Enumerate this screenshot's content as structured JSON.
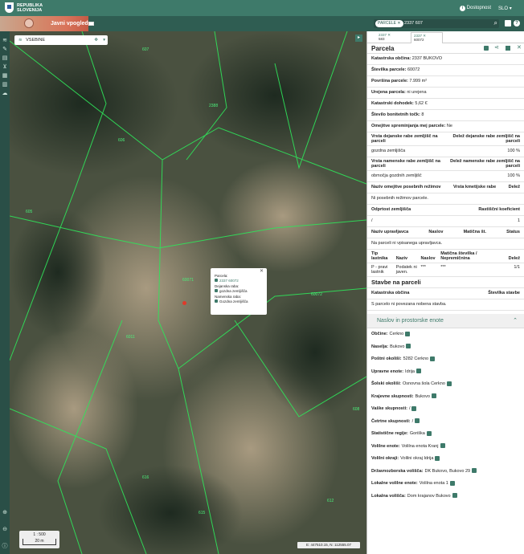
{
  "topbar": {
    "logo_line1": "REPUBLIKA",
    "logo_line2": "SLOVENIJA",
    "accessibility": "Dostopnost",
    "language": "SLO"
  },
  "subbar": {
    "app_title": "Javni vpogled",
    "search_chip": "PARCELE",
    "search_value": "2337 607"
  },
  "map": {
    "layer_select": "VSEBINE",
    "scale_ratio": "1 : 500",
    "scale_length": "20 m",
    "coords": "E: 447510.15, N: 112555.07",
    "popup": {
      "parcel_label": "Parcela:",
      "parcel_value": "2337 60072",
      "dejanska_label": "Dejanska raba:",
      "dejanska_value": "gozdna zemljišča",
      "namenska_label": "Namenska raba:",
      "namenska_value": "Gozdna zemljišča"
    },
    "parcel_labels": [
      "607",
      "2388",
      "606",
      "605",
      "60071",
      "60072",
      "608",
      "6011",
      "616",
      "615",
      "612"
    ]
  },
  "panel": {
    "tab1_line1": "2337 ✕",
    "tab1_line2": "583",
    "tab2_line1": "2337 ✕",
    "tab2_line2": "60072",
    "title": "Parcela",
    "katastrska_obcina_label": "Katastrska občina:",
    "katastrska_obcina_value": "2337 BUKOVO",
    "stevilka_label": "Številka parcele:",
    "stevilka_value": "60072",
    "povrsina_label": "Površina parcele:",
    "povrsina_value": "7.999 m²",
    "urejena_label": "Urejena parcela:",
    "urejena_value": "ni urejena",
    "dohodek_label": "Katastrski dohodek:",
    "dohodek_value": "5,62 €",
    "tock_label": "Število bonitetnih točk:",
    "tock_value": "8",
    "omejitve_label": "Omejitve spreminjanja mej parcele:",
    "omejitve_value": "Ne",
    "dej_head1": "Vrsta dejanske rabe zemljišč na parceli",
    "dej_head2": "Delež dejanske rabe zemljišč na parceli",
    "dej_val1": "gozdna zemljišča",
    "dej_val2": "100 %",
    "nam_head1": "Vrsta namenske rabe zemljišč na parceli",
    "nam_head2": "Delež namenske rabe zemljišč na parceli",
    "nam_val1": "območja gozdnih zemljišč",
    "nam_val2": "100 %",
    "rez_head1": "Naziv omejitve posebnih režimov",
    "rez_head2": "Vrsta kmetijske rabe",
    "rez_head3": "Delež",
    "rez_note": "Ni posebnih režimov parcele.",
    "odp_head1": "Odprtost zemljišča",
    "odp_head2": "Rastiščni koeficient",
    "odp_val1": "/",
    "odp_val2": "1",
    "upr_h1": "Naziv upravljavca",
    "upr_h2": "Naslov",
    "upr_h3": "Matična št.",
    "upr_h4": "Status",
    "upr_note": "Na parceli ni vpisanega upravljavca.",
    "last_h1": "Tip lastnika",
    "last_h2": "Naziv",
    "last_h3": "Naslov",
    "last_h4": "Matična številka / Nepremičnina",
    "last_h5": "Delež",
    "last_v1": "P - pravi lastnik",
    "last_v2": "Podatek ni javen.",
    "last_v3": "***",
    "last_v4": "***",
    "last_v5": "1/1",
    "stavbe_title": "Stavbe na parceli",
    "stavbe_h1": "Katastrska občina",
    "stavbe_h2": "Številka stavbe",
    "stavbe_note": "S parcelo ni povezana nobena stavba.",
    "naslov_section": "Naslov in prostorske enote",
    "enote": [
      {
        "label": "Občine:",
        "value": "Cerkno"
      },
      {
        "label": "Naselja:",
        "value": "Bukovo"
      },
      {
        "label": "Poštni okoliši:",
        "value": "5282 Cerkno"
      },
      {
        "label": "Upravne enote:",
        "value": "Idrija"
      },
      {
        "label": "Šolski okoliši:",
        "value": "Osnovna šola Cerkno"
      },
      {
        "label": "Krajevne skupnosti:",
        "value": "Bukovo"
      },
      {
        "label": "Vaške skupnosti:",
        "value": "/"
      },
      {
        "label": "Četrtne skupnosti:",
        "value": "/"
      },
      {
        "label": "Statistične regije:",
        "value": "Goriška"
      },
      {
        "label": "Volilne enote:",
        "value": "Volilna enota Kranj"
      },
      {
        "label": "Volilni okraji:",
        "value": "Volilni okraj Idrija"
      },
      {
        "label": "Državnozborska volišča:",
        "value": "DK Bukovo, Bukovo 29"
      },
      {
        "label": "Lokalne volilne enote:",
        "value": "Volilna enota 1"
      },
      {
        "label": "Lokalna volišča:",
        "value": "Dom krajanov Bukovo"
      }
    ]
  }
}
